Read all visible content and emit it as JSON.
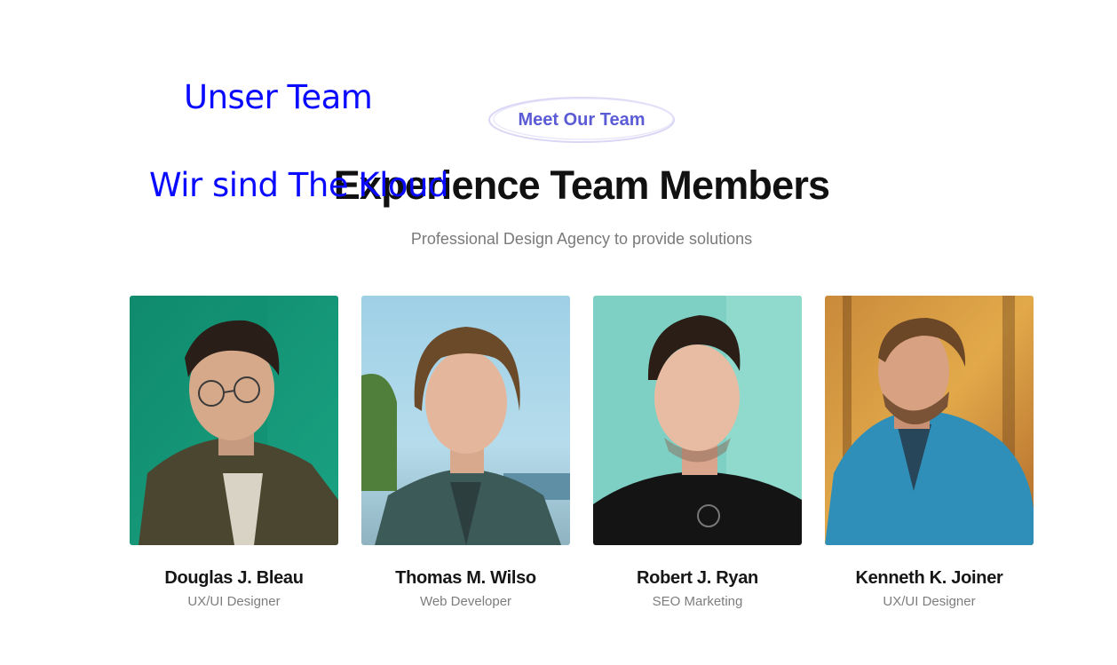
{
  "overlay": {
    "line1": "Unser Team",
    "line2": "Wir sind The Kloud"
  },
  "section": {
    "eyebrow": "Meet Our Team",
    "title": "Experience Team Members",
    "subtitle": "Professional Design Agency to provide solutions"
  },
  "colors": {
    "accent": "#5b5bd6",
    "overlay_text": "#0a0aff"
  },
  "team": [
    {
      "name": "Douglas J. Bleau",
      "role": "UX/UI Designer",
      "photo": "portrait-green-backdrop"
    },
    {
      "name": "Thomas M. Wilso",
      "role": "Web Developer",
      "photo": "portrait-outdoor-seaside"
    },
    {
      "name": "Robert J. Ryan",
      "role": "SEO Marketing",
      "photo": "portrait-teal-wall"
    },
    {
      "name": "Kenneth K. Joiner",
      "role": "UX/UI Designer",
      "photo": "portrait-autumn-forest"
    }
  ]
}
